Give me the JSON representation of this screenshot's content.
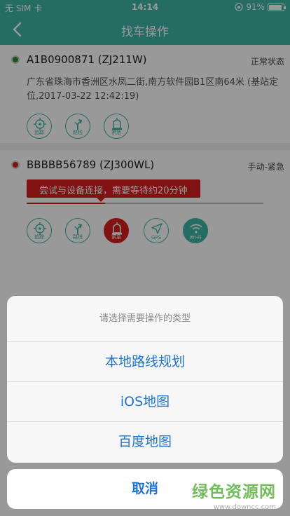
{
  "status_bar": {
    "carrier": "无 SIM 卡",
    "time": "14:14",
    "battery": "91%",
    "battery_level": 0.91
  },
  "nav": {
    "title": "找车操作"
  },
  "vehicles": [
    {
      "plate": "A1B0900871 (ZJ211W)",
      "status": "正常状态",
      "address": "广东省珠海市香洲区水凤二街,南方软件园B1区南64米 (基站定位,2017-03-22 12:42:19)",
      "dot_color": "#2e8b2e",
      "buttons": [
        {
          "label": "追踪",
          "icon": "crosshair-icon"
        },
        {
          "label": "路线",
          "icon": "route-icon"
        },
        {
          "label": "紧急",
          "icon": "siren-icon"
        }
      ]
    },
    {
      "plate": "BBBBB56789 (ZJ300WL)",
      "status": "手动-紧急",
      "tip": "尝试与设备连接，需要等待约20分钟",
      "dot_color": "#d5201e",
      "progress": 0.33,
      "buttons": [
        {
          "label": "追踪",
          "icon": "crosshair-icon"
        },
        {
          "label": "路线",
          "icon": "route-icon"
        },
        {
          "label": "紧急",
          "icon": "siren-icon"
        },
        {
          "label": "GPS",
          "icon": "gps-arrow-icon"
        },
        {
          "label": "Wi-Fi",
          "icon": "wifi-icon"
        }
      ]
    }
  ],
  "action_sheet": {
    "title": "请选择需要操作的类型",
    "options": [
      "本地路线规划",
      "iOS地图",
      "百度地图"
    ],
    "cancel": "取消"
  },
  "watermark": {
    "brand": "绿色资源网",
    "url": "www.downcc.com"
  },
  "colors": {
    "accent": "#3fb5a5",
    "alert": "#d5201e",
    "link": "#1e73d6"
  }
}
